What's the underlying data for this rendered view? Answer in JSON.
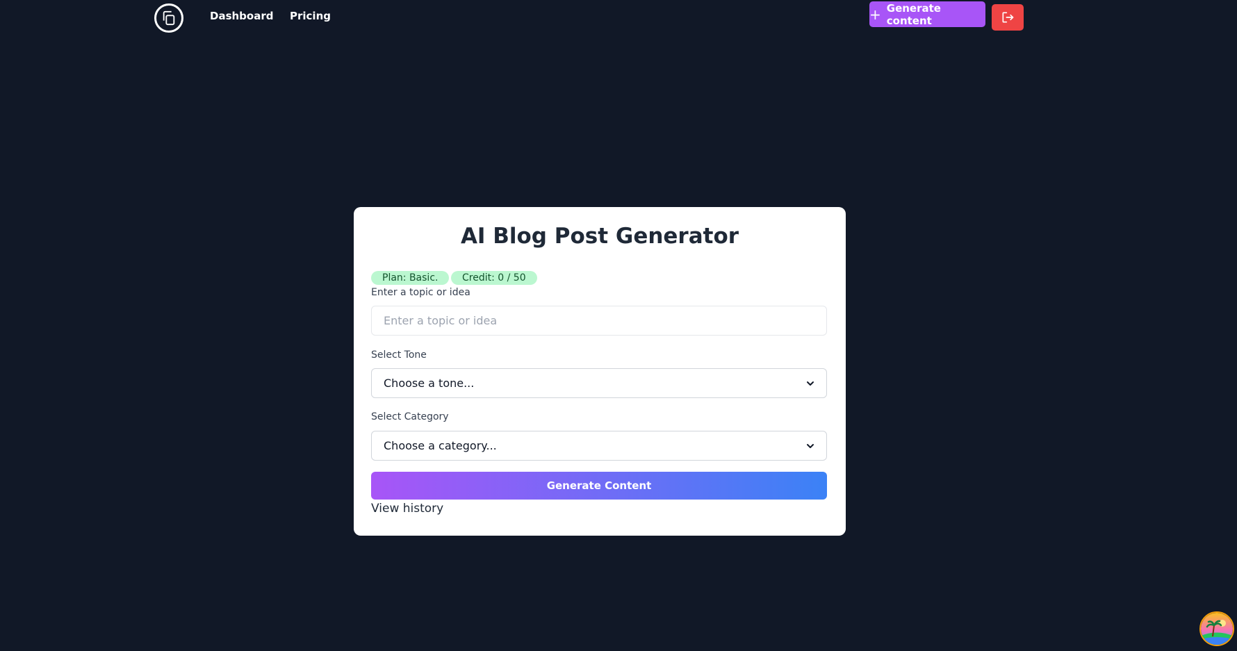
{
  "nav": {
    "logo_icon": "copy-icon",
    "links": [
      {
        "label": "Dashboard"
      },
      {
        "label": "Pricing"
      }
    ],
    "generate_button": {
      "label": "Generate content",
      "icon": "plus-icon",
      "color": "#a855f7"
    },
    "logout_button": {
      "icon": "logout-icon",
      "color": "#ef4444"
    }
  },
  "form": {
    "title": "AI Blog Post Generator",
    "badges": {
      "plan": "Plan: Basic.",
      "credit": "Credit: 0 / 50"
    },
    "topic": {
      "label": "Enter a topic or idea",
      "placeholder": "Enter a topic or idea",
      "value": ""
    },
    "tone": {
      "label": "Select Tone",
      "selected": "Choose a tone..."
    },
    "category": {
      "label": "Select Category",
      "selected": "Choose a category..."
    },
    "submit_label": "Generate Content",
    "history_link": "View history"
  },
  "colors": {
    "background": "#111827",
    "card": "#ffffff",
    "badge_bg": "#bbf7d0",
    "gradient_start": "#a855f7",
    "gradient_end": "#3b82f6"
  },
  "corner_avatar": {
    "icon": "beach-avatar-icon"
  }
}
